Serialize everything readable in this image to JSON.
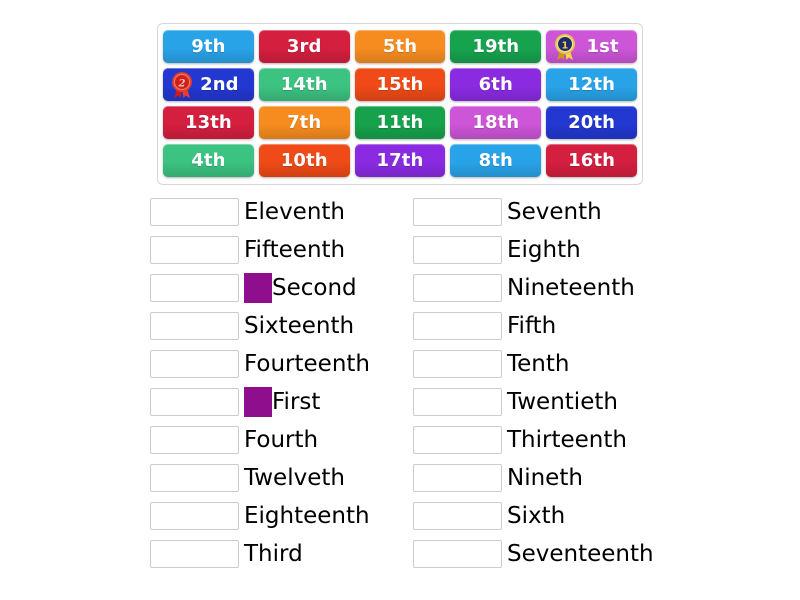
{
  "activity": {
    "type": "match-up",
    "tile_bank": {
      "rows": [
        [
          {
            "label": "9th",
            "color": "#29a3e8",
            "medal": null
          },
          {
            "label": "3rd",
            "color": "#d41f3f",
            "medal": null
          },
          {
            "label": "5th",
            "color": "#f68c20",
            "medal": null
          },
          {
            "label": "19th",
            "color": "#17a34e",
            "medal": null
          },
          {
            "label": "1st",
            "color": "#cd55d8",
            "medal": "gold-rosette-medal-icon"
          }
        ],
        [
          {
            "label": "2nd",
            "color": "#2238d0",
            "medal": "red-rosette-medal-icon"
          },
          {
            "label": "14th",
            "color": "#3cc281",
            "medal": null
          },
          {
            "label": "15th",
            "color": "#ef4a17",
            "medal": null
          },
          {
            "label": "6th",
            "color": "#8a2be2",
            "medal": null
          },
          {
            "label": "12th",
            "color": "#29a3e8",
            "medal": null
          }
        ],
        [
          {
            "label": "13th",
            "color": "#d41f3f",
            "medal": null
          },
          {
            "label": "7th",
            "color": "#f68c20",
            "medal": null
          },
          {
            "label": "11th",
            "color": "#16a24c",
            "medal": null
          },
          {
            "label": "18th",
            "color": "#cd55d8",
            "medal": null
          },
          {
            "label": "20th",
            "color": "#2238d0",
            "medal": null
          }
        ],
        [
          {
            "label": "4th",
            "color": "#3cc281",
            "medal": null
          },
          {
            "label": "10th",
            "color": "#ef4a17",
            "medal": null
          },
          {
            "label": "17th",
            "color": "#8a2be2",
            "medal": null
          },
          {
            "label": "8th",
            "color": "#29a3e8",
            "medal": null
          },
          {
            "label": "16th",
            "color": "#d41f3f",
            "medal": null
          }
        ]
      ]
    },
    "answers": {
      "left_column": [
        {
          "text": "Eleventh",
          "swatch": null
        },
        {
          "text": "Fifteenth",
          "swatch": null
        },
        {
          "text": "Second",
          "swatch": "#8e0e8e"
        },
        {
          "text": "Sixteenth",
          "swatch": null
        },
        {
          "text": "Fourteenth",
          "swatch": null
        },
        {
          "text": "First",
          "swatch": "#8e0e8e"
        },
        {
          "text": "Fourth",
          "swatch": null
        },
        {
          "text": "Twelveth",
          "swatch": null
        },
        {
          "text": "Eighteenth",
          "swatch": null
        },
        {
          "text": "Third",
          "swatch": null
        }
      ],
      "right_column": [
        {
          "text": "Seventh",
          "swatch": null
        },
        {
          "text": "Eighth",
          "swatch": null
        },
        {
          "text": "Nineteenth",
          "swatch": null
        },
        {
          "text": "Fifth",
          "swatch": null
        },
        {
          "text": "Tenth",
          "swatch": null
        },
        {
          "text": "Twentieth",
          "swatch": null
        },
        {
          "text": "Thirteenth",
          "swatch": null
        },
        {
          "text": "Nineth",
          "swatch": null
        },
        {
          "text": "Sixth",
          "swatch": null
        },
        {
          "text": "Seventeenth",
          "swatch": null
        }
      ]
    }
  }
}
